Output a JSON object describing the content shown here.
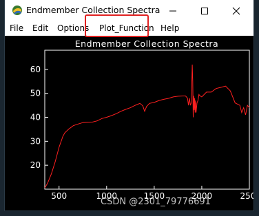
{
  "window": {
    "title": "Endmember Collection Spectra",
    "icon": "idl-app-icon",
    "controls": {
      "minimize": "—",
      "maximize": "☐",
      "close": "✕"
    }
  },
  "menu": {
    "items": [
      "File",
      "Edit",
      "Options",
      "Plot_Function",
      "Help"
    ],
    "highlighted": "Plot_Function",
    "highlight_color": "#e02020"
  },
  "plot": {
    "background": "#000000",
    "foreground": "#ffffff",
    "line_color": "#ff2020"
  },
  "chart_data": {
    "type": "line",
    "title": "Endmember Collection Spectra",
    "xlabel": "",
    "ylabel": "",
    "x_ticks": [
      "500",
      "1000",
      "1500",
      "2000",
      "250"
    ],
    "y_ticks": [
      "20",
      "30",
      "40",
      "50",
      "60"
    ],
    "xlim": [
      350,
      2500
    ],
    "ylim": [
      10,
      68
    ],
    "series": [
      {
        "x": [
          350,
          380,
          420,
          460,
          500,
          540,
          560,
          600,
          650,
          700,
          750,
          800,
          850,
          900,
          950,
          1000,
          1050,
          1100,
          1150,
          1200,
          1250,
          1300,
          1350,
          1380,
          1400,
          1420,
          1450,
          1500,
          1550,
          1600,
          1650,
          1700,
          1750,
          1800,
          1830,
          1850,
          1860,
          1870,
          1880,
          1890,
          1900,
          1905,
          1910,
          1915,
          1920,
          1925,
          1930,
          1935,
          1940,
          1950,
          1960,
          1970,
          1980,
          2000,
          2050,
          2100,
          2150,
          2200,
          2250,
          2300,
          2350,
          2400,
          2420,
          2440,
          2460,
          2480,
          2500
        ],
        "y": [
          10.5,
          12.5,
          16.5,
          21.5,
          27.5,
          32,
          33.5,
          35,
          36.5,
          37.2,
          37.8,
          37.9,
          38,
          38.5,
          39.5,
          40,
          40.7,
          41.5,
          42.5,
          43.3,
          44,
          45,
          45.8,
          44.8,
          42.5,
          44.5,
          45.8,
          46.2,
          47,
          47.5,
          47.9,
          48.5,
          48.8,
          48.9,
          48.9,
          48,
          45,
          48,
          45,
          46,
          62,
          55,
          40,
          49,
          43,
          48,
          42,
          47,
          42,
          46,
          47,
          49.5,
          49,
          48.5,
          50.5,
          50.5,
          52,
          52.5,
          53,
          51,
          46,
          45,
          42,
          44,
          41,
          45,
          44
        ]
      }
    ]
  },
  "watermark": "CSDN @2301_79776691"
}
